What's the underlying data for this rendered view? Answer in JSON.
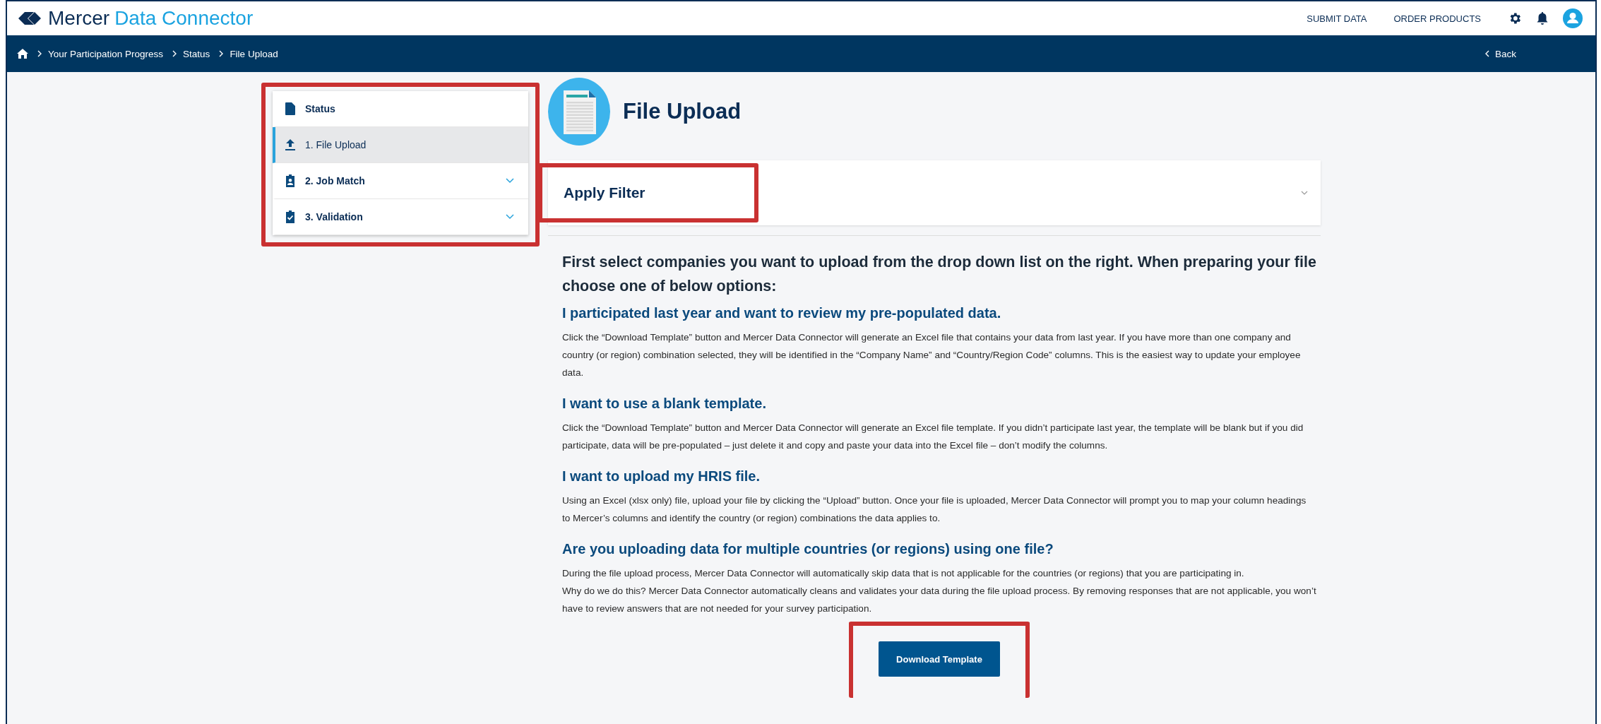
{
  "app": {
    "brand": "Mercer",
    "product": "Data Connector"
  },
  "top_nav": [
    {
      "label": "SUBMIT DATA"
    },
    {
      "label": "ORDER PRODUCTS"
    }
  ],
  "breadcrumb": [
    "Your Participation Progress",
    "Status",
    "File Upload"
  ],
  "back_link": "Back",
  "sidebar": {
    "highlighted": true,
    "items": [
      {
        "label": "Status",
        "selected": false,
        "expandable": false
      },
      {
        "label": "1. File Upload",
        "selected": true,
        "expandable": false
      },
      {
        "label": "2. Job Match",
        "selected": false,
        "expandable": true
      },
      {
        "label": "3. Validation",
        "selected": false,
        "expandable": true
      }
    ]
  },
  "page_title": "File Upload",
  "filter": {
    "label": "Apply Filter",
    "expanded": false,
    "highlighted": true
  },
  "intro": "First select companies you want to upload from the drop down list on the right. When preparing your file choose one of below options:",
  "sections": [
    {
      "heading": "I participated last year and want to review my pre-populated data.",
      "paragraphs": [
        "Click the “Download Template” button and Mercer Data Connector will generate an Excel file that contains your data from last year. If you have more than one company and country (or region) combination selected, they will be identified in the “Company Name” and “Country/Region Code” columns. This is the easiest way to update your employee data."
      ]
    },
    {
      "heading": "I want to use a blank template.",
      "paragraphs": [
        "Click the “Download Template” button and Mercer Data Connector will generate an Excel file template. If you didn’t participate last year, the template will be blank but if you did participate, data will be pre-populated – just delete it and copy and paste your data into the Excel file – don’t modify the columns."
      ]
    },
    {
      "heading": "I want to upload my HRIS file.",
      "paragraphs": [
        "Using an Excel (xlsx only) file, upload your file by clicking the “Upload” button. Once your file is uploaded, Mercer Data Connector will prompt you to map your column headings to Mercer’s columns and identify the country (or region) combinations the data applies to."
      ]
    },
    {
      "heading": "Are you uploading data for multiple countries (or regions) using one file?",
      "paragraphs": [
        "During the file upload process, Mercer Data Connector will automatically skip data that is not applicable for the countries (or regions) that you are participating in.",
        "Why do we do this? Mercer Data Connector automatically cleans and validates your data during the file upload process. By removing responses that are not applicable, you won’t have to review answers that are not needed for your survey participation."
      ]
    }
  ],
  "download_button": {
    "label": "Download Template",
    "highlighted": true
  }
}
